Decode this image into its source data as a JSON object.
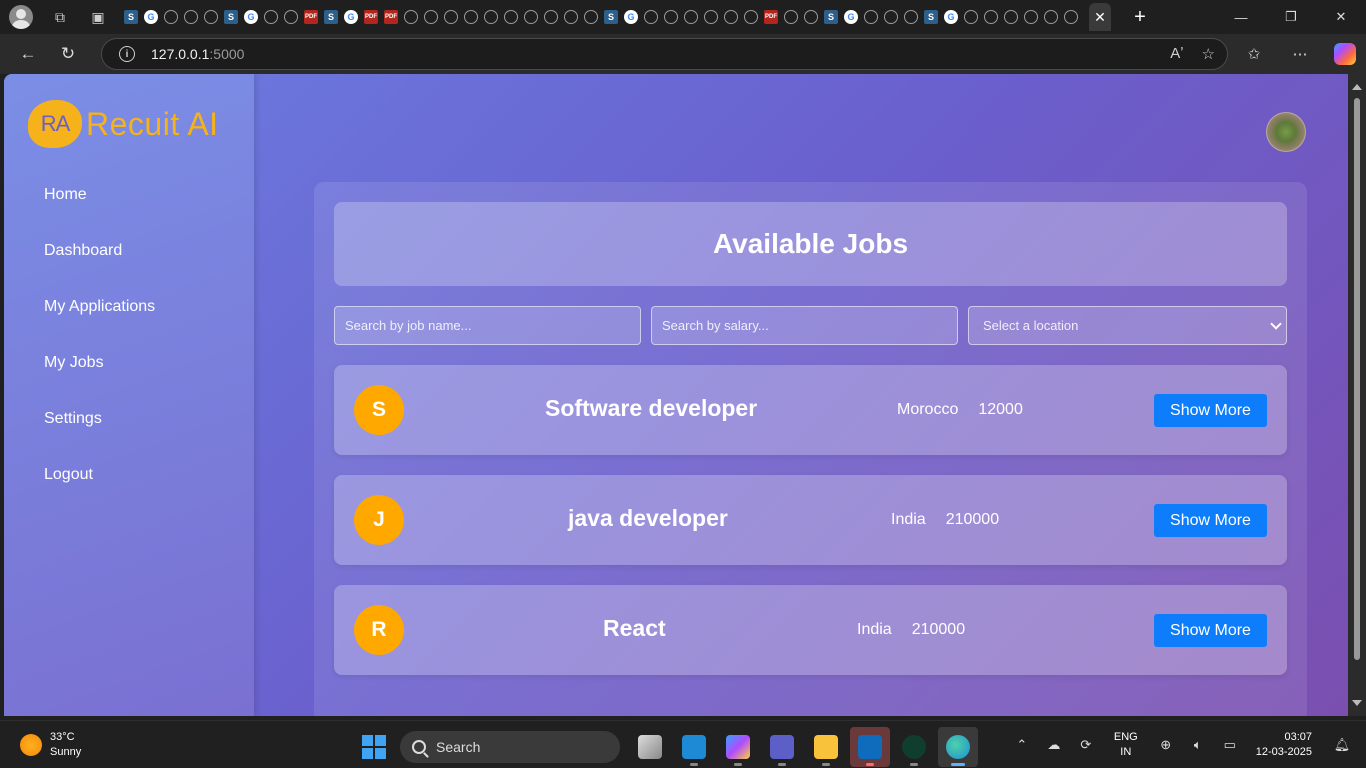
{
  "browser": {
    "tab_favicons": [
      "S",
      "G",
      "W",
      "W",
      "W",
      "S",
      "G",
      "W",
      "W",
      "P",
      "S",
      "G",
      "P",
      "P",
      "W",
      "W",
      "W",
      "W",
      "W",
      "W",
      "W",
      "W",
      "W",
      "W",
      "S",
      "G",
      "W",
      "W",
      "W",
      "W",
      "W",
      "W",
      "P",
      "W",
      "W",
      "S",
      "G",
      "W",
      "W",
      "W",
      "S",
      "G",
      "W",
      "W",
      "W",
      "W",
      "W",
      "W"
    ],
    "active_tab_close": "✕",
    "new_tab": "+",
    "url_host": "127.0.0.1",
    "url_port": ":5000"
  },
  "app": {
    "logo_badge": "RA",
    "logo_text": "Recuit AI",
    "nav": [
      "Home",
      "Dashboard",
      "My Applications",
      "My Jobs",
      "Settings",
      "Logout"
    ],
    "title": "Available Jobs",
    "filters": {
      "job_name_placeholder": "Search by job name...",
      "salary_placeholder": "Search by salary...",
      "location_selected": "Select a location"
    },
    "jobs": [
      {
        "initial": "S",
        "name": "Software developer",
        "location": "Morocco",
        "salary": "12000",
        "button": "Show More"
      },
      {
        "initial": "J",
        "name": "java developer",
        "location": "India",
        "salary": "210000",
        "button": "Show More"
      },
      {
        "initial": "R",
        "name": "React",
        "location": "India",
        "salary": "210000",
        "button": "Show More"
      }
    ]
  },
  "taskbar": {
    "temperature": "33°C",
    "condition": "Sunny",
    "search_label": "Search",
    "lang_line1": "ENG",
    "lang_line2": "IN",
    "time": "03:07",
    "date": "12-03-2025"
  },
  "colors": {
    "accent_orange": "#ffa800",
    "button_blue": "#0d7dfb",
    "logo_gold": "#f6b21a"
  }
}
